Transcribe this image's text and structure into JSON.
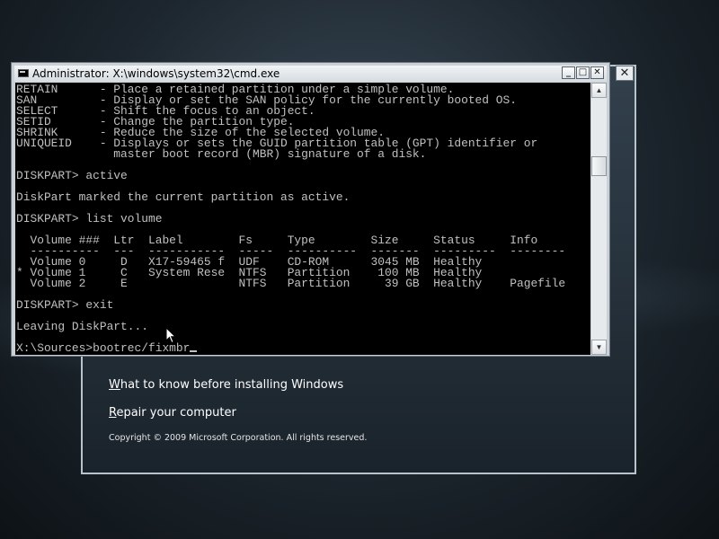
{
  "setup": {
    "close_label": "✕",
    "link1": {
      "first_letter": "W",
      "rest": "hat to know before installing Windows"
    },
    "link2": {
      "first_letter": "R",
      "rest": "epair your computer"
    },
    "copyright": "Copyright © 2009 Microsoft Corporation. All rights reserved."
  },
  "cmd": {
    "title": "Administrator: X:\\windows\\system32\\cmd.exe",
    "minimize_label": "_",
    "maximize_label": "□",
    "close_label": "✕",
    "console_text": "RETAIN      - Place a retained partition under a simple volume.\nSAN         - Display or set the SAN policy for the currently booted OS.\nSELECT      - Shift the focus to an object.\nSETID       - Change the partition type.\nSHRINK      - Reduce the size of the selected volume.\nUNIQUEID    - Displays or sets the GUID partition table (GPT) identifier or\n              master boot record (MBR) signature of a disk.\n\nDISKPART> active\n\nDiskPart marked the current partition as active.\n\nDISKPART> list volume\n\n  Volume ###  Ltr  Label        Fs     Type        Size     Status     Info\n  ----------  ---  -----------  -----  ----------  -------  ---------  --------\n  Volume 0     D   X17-59465 f  UDF    CD-ROM      3045 MB  Healthy\n* Volume 1     C   System Rese  NTFS   Partition    100 MB  Healthy\n  Volume 2     E                NTFS   Partition     39 GB  Healthy    Pagefile\n\nDISKPART> exit\n\nLeaving DiskPart...\n\n",
    "prompt_line": "X:\\Sources>bootrec/fixmbr",
    "scroll_up": "▲",
    "scroll_down": "▼"
  }
}
